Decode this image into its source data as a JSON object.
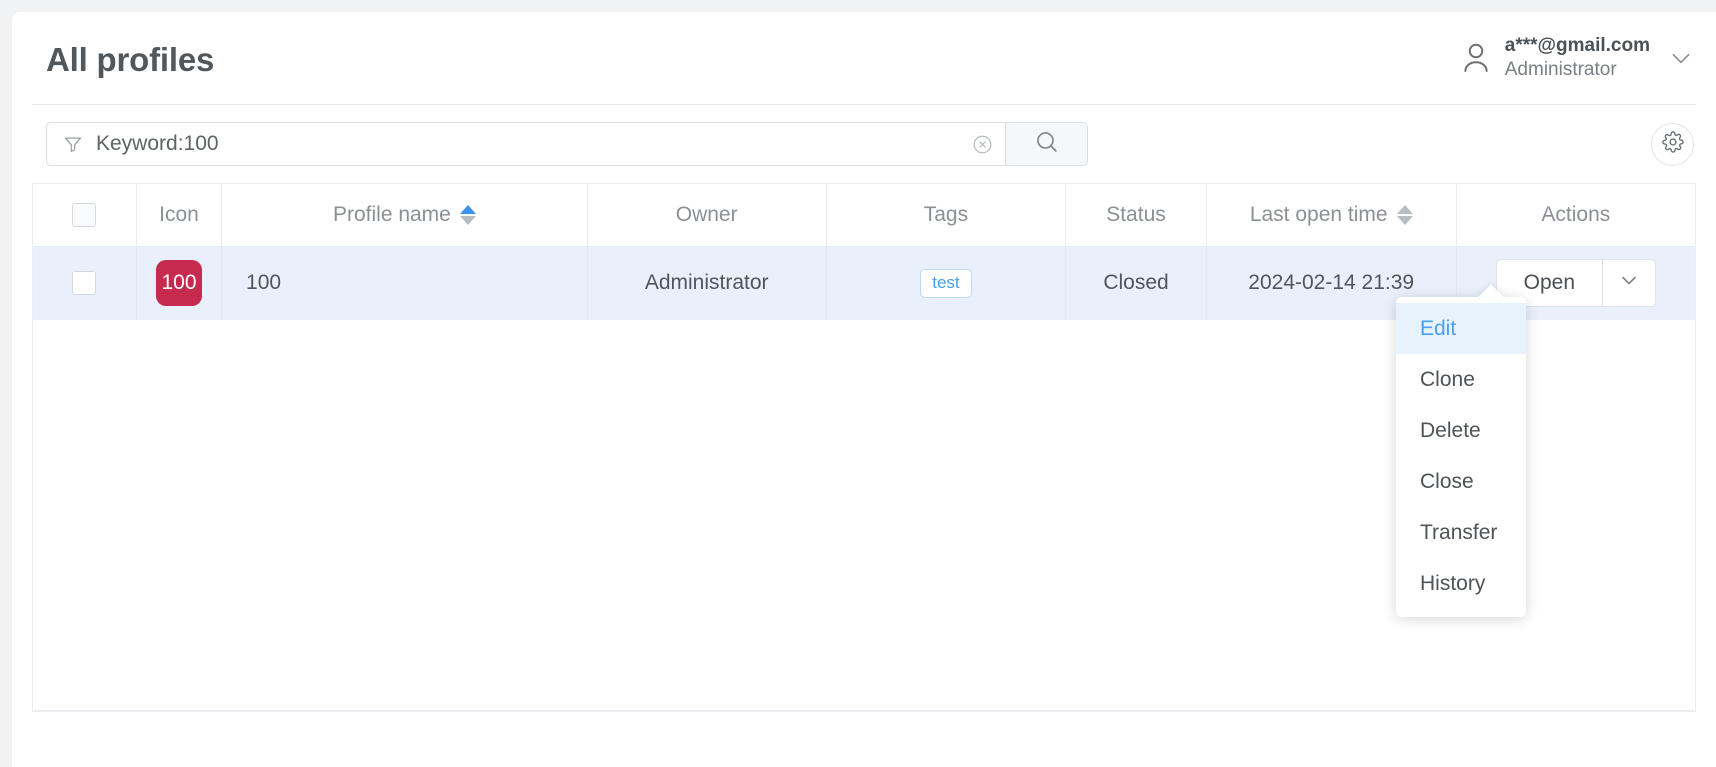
{
  "header": {
    "title": "All profiles",
    "account": {
      "icon": "user-icon",
      "email": "a***@gmail.com",
      "role": "Administrator",
      "caret": "chevron-down-icon"
    }
  },
  "toolbar": {
    "filter_icon": "filter-icon",
    "search_value": "Keyword:100",
    "search_placeholder": "Keyword",
    "clear_icon": "close-circle-icon",
    "search_icon": "search-icon",
    "settings_icon": "gear-icon"
  },
  "table": {
    "columns": [
      {
        "key": "select",
        "label": "",
        "sort": "none"
      },
      {
        "key": "icon",
        "label": "Icon",
        "sort": "none"
      },
      {
        "key": "profile_name",
        "label": "Profile name",
        "sort": "asc"
      },
      {
        "key": "owner",
        "label": "Owner",
        "sort": "none"
      },
      {
        "key": "tags",
        "label": "Tags",
        "sort": "none"
      },
      {
        "key": "status",
        "label": "Status",
        "sort": "none"
      },
      {
        "key": "last_open_time",
        "label": "Last open time",
        "sort": "both"
      },
      {
        "key": "actions",
        "label": "Actions",
        "sort": "none"
      }
    ],
    "rows": [
      {
        "selected": false,
        "icon_label": "100",
        "icon_color": "#c62a4f",
        "profile_name": "100",
        "owner": "Administrator",
        "tags": [
          "test"
        ],
        "status": "Closed",
        "last_open_time": "2024-02-14 21:39",
        "action_label": "Open",
        "action_caret": "chevron-down-icon"
      }
    ]
  },
  "dropdown": {
    "open": true,
    "items": [
      {
        "label": "Edit",
        "active": true
      },
      {
        "label": "Clone",
        "active": false
      },
      {
        "label": "Delete",
        "active": false
      },
      {
        "label": "Close",
        "active": false
      },
      {
        "label": "Transfer",
        "active": false
      },
      {
        "label": "History",
        "active": false
      }
    ]
  },
  "colors": {
    "accent": "#49a0f0",
    "row_selected_bg": "#e9f0fb",
    "profile_icon": "#c62a4f",
    "page_bg": "#f1f2f4"
  }
}
